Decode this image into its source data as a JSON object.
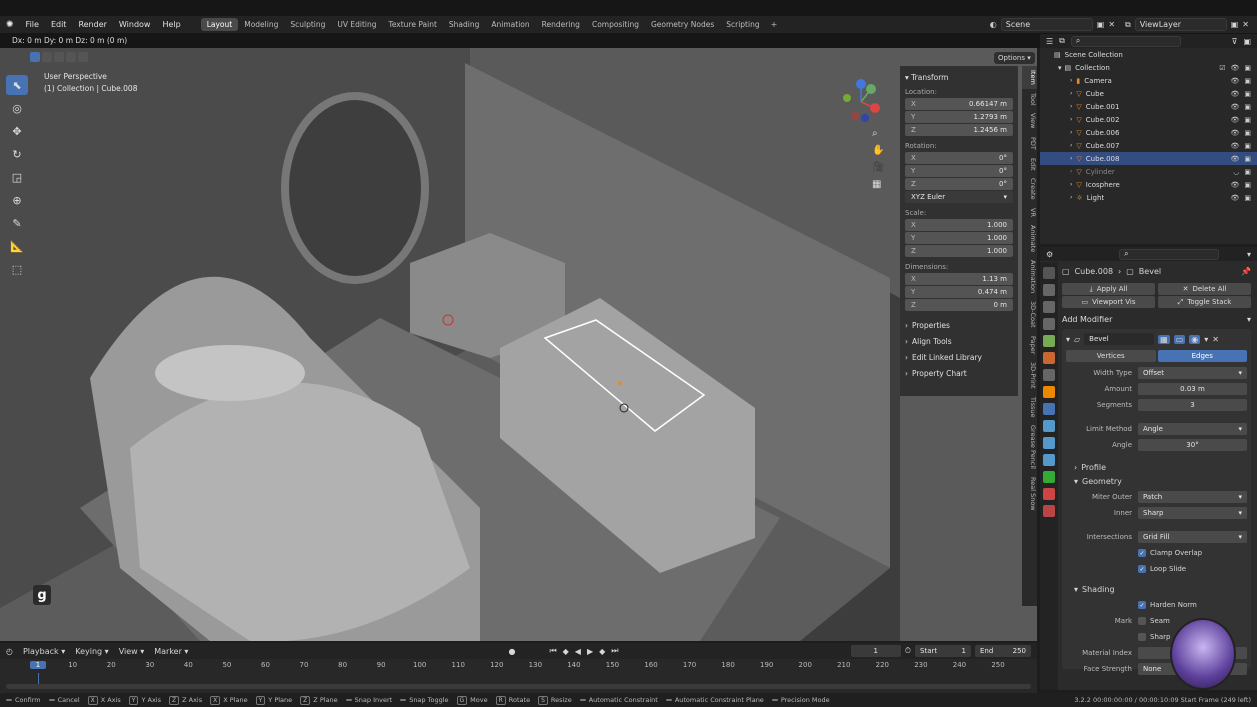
{
  "menu": [
    "File",
    "Edit",
    "Render",
    "Window",
    "Help"
  ],
  "workspaces": [
    "Layout",
    "Modeling",
    "Sculpting",
    "UV Editing",
    "Texture Paint",
    "Shading",
    "Animation",
    "Rendering",
    "Compositing",
    "Geometry Nodes",
    "Scripting"
  ],
  "add_workspace": "+",
  "scene": "Scene",
  "view_layer": "ViewLayer",
  "header_info": "Dx: 0 m  Dy: 0 m  Dz: 0 m (0 m)",
  "viewport": {
    "perspective": "User Perspective",
    "collection_info": "(1) Collection | Cube.008",
    "options": "Options",
    "key_overlay": "g"
  },
  "npanel": {
    "title": "Transform",
    "location_label": "Location:",
    "location": [
      {
        "ax": "X",
        "v": "0.66147 m"
      },
      {
        "ax": "Y",
        "v": "1.2793 m"
      },
      {
        "ax": "Z",
        "v": "1.2456 m"
      }
    ],
    "rotation_label": "Rotation:",
    "rotation": [
      {
        "ax": "X",
        "v": "0°"
      },
      {
        "ax": "Y",
        "v": "0°"
      },
      {
        "ax": "Z",
        "v": "0°"
      }
    ],
    "rotation_mode": "XYZ Euler",
    "scale_label": "Scale:",
    "scale": [
      {
        "ax": "X",
        "v": "1.000"
      },
      {
        "ax": "Y",
        "v": "1.000"
      },
      {
        "ax": "Z",
        "v": "1.000"
      }
    ],
    "dimensions_label": "Dimensions:",
    "dimensions": [
      {
        "ax": "X",
        "v": "1.13 m"
      },
      {
        "ax": "Y",
        "v": "0.474 m"
      },
      {
        "ax": "Z",
        "v": "0 m"
      }
    ],
    "sections": [
      "Properties",
      "Align Tools",
      "Edit Linked Library",
      "Property Chart"
    ]
  },
  "side_tabs": [
    "Item",
    "Tool",
    "View",
    "PDT",
    "Edit",
    "Create",
    "VR",
    "Animate",
    "Animation",
    "3D-Coat",
    "Paper",
    "3D-Print",
    "Tissue",
    "Grease Pencil",
    "Real Snow"
  ],
  "outliner": {
    "root": "Scene Collection",
    "collection": "Collection",
    "items": [
      {
        "name": "Camera",
        "sel": false,
        "dim": false
      },
      {
        "name": "Cube",
        "sel": false,
        "dim": false
      },
      {
        "name": "Cube.001",
        "sel": false,
        "dim": false
      },
      {
        "name": "Cube.002",
        "sel": false,
        "dim": false
      },
      {
        "name": "Cube.006",
        "sel": false,
        "dim": false
      },
      {
        "name": "Cube.007",
        "sel": false,
        "dim": false
      },
      {
        "name": "Cube.008",
        "sel": true,
        "dim": false
      },
      {
        "name": "Cylinder",
        "sel": false,
        "dim": true
      },
      {
        "name": "Icosphere",
        "sel": false,
        "dim": false
      },
      {
        "name": "Light",
        "sel": false,
        "dim": false
      }
    ]
  },
  "properties": {
    "breadcrumb_object": "Cube.008",
    "breadcrumb_modifier": "Bevel",
    "apply_all": "Apply All",
    "delete_all": "Delete All",
    "viewport_vis": "Viewport Vis",
    "toggle_stack": "Toggle Stack",
    "add_modifier": "Add Modifier",
    "modifier_name": "Bevel",
    "tab_vertices": "Vertices",
    "tab_edges": "Edges",
    "width_type_label": "Width Type",
    "width_type": "Offset",
    "amount_label": "Amount",
    "amount": "0.03 m",
    "segments_label": "Segments",
    "segments": "3",
    "limit_method_label": "Limit Method",
    "limit_method": "Angle",
    "angle_label": "Angle",
    "angle": "30°",
    "profile": "Profile",
    "geometry": "Geometry",
    "miter_outer_label": "Miter Outer",
    "miter_outer": "Patch",
    "inner_label": "Inner",
    "inner": "Sharp",
    "intersections_label": "Intersections",
    "intersections": "Grid Fill",
    "clamp_overlap": "Clamp Overlap",
    "loop_slide": "Loop Slide",
    "shading": "Shading",
    "harden_normals": "Harden Norm",
    "mark_label": "Mark",
    "seam": "Seam",
    "sharp": "Sharp",
    "material_index_label": "Material Index",
    "face_strength_label": "Face Strength",
    "face_strength": "None"
  },
  "timeline": {
    "menu": [
      "Playback",
      "Keying",
      "View",
      "Marker"
    ],
    "current_frame": "1",
    "start_label": "Start",
    "start": "1",
    "end_label": "End",
    "end": "250",
    "ticks": [
      "1",
      "10",
      "20",
      "30",
      "40",
      "50",
      "60",
      "70",
      "80",
      "90",
      "100",
      "110",
      "120",
      "130",
      "140",
      "150",
      "160",
      "170",
      "180",
      "190",
      "200",
      "210",
      "220",
      "230",
      "240",
      "250"
    ]
  },
  "status": {
    "items": [
      {
        "k": "",
        "t": "Confirm"
      },
      {
        "k": "",
        "t": "Cancel"
      },
      {
        "k": "X",
        "t": "X Axis"
      },
      {
        "k": "Y",
        "t": "Y Axis"
      },
      {
        "k": "Z",
        "t": "Z Axis"
      },
      {
        "k": "X",
        "t": "X Plane"
      },
      {
        "k": "Y",
        "t": "Y Plane"
      },
      {
        "k": "Z",
        "t": "Z Plane"
      },
      {
        "k": "",
        "t": "Snap Invert"
      },
      {
        "k": "",
        "t": "Snap Toggle"
      },
      {
        "k": "G",
        "t": "Move"
      },
      {
        "k": "R",
        "t": "Rotate"
      },
      {
        "k": "S",
        "t": "Resize"
      },
      {
        "k": "",
        "t": "Automatic Constraint"
      },
      {
        "k": "",
        "t": "Automatic Constraint Plane"
      },
      {
        "k": "",
        "t": "Precision Mode"
      }
    ],
    "right": "3.2.2  00:00:00:00 / 00:00:10:09  Start Frame (249 left)"
  }
}
